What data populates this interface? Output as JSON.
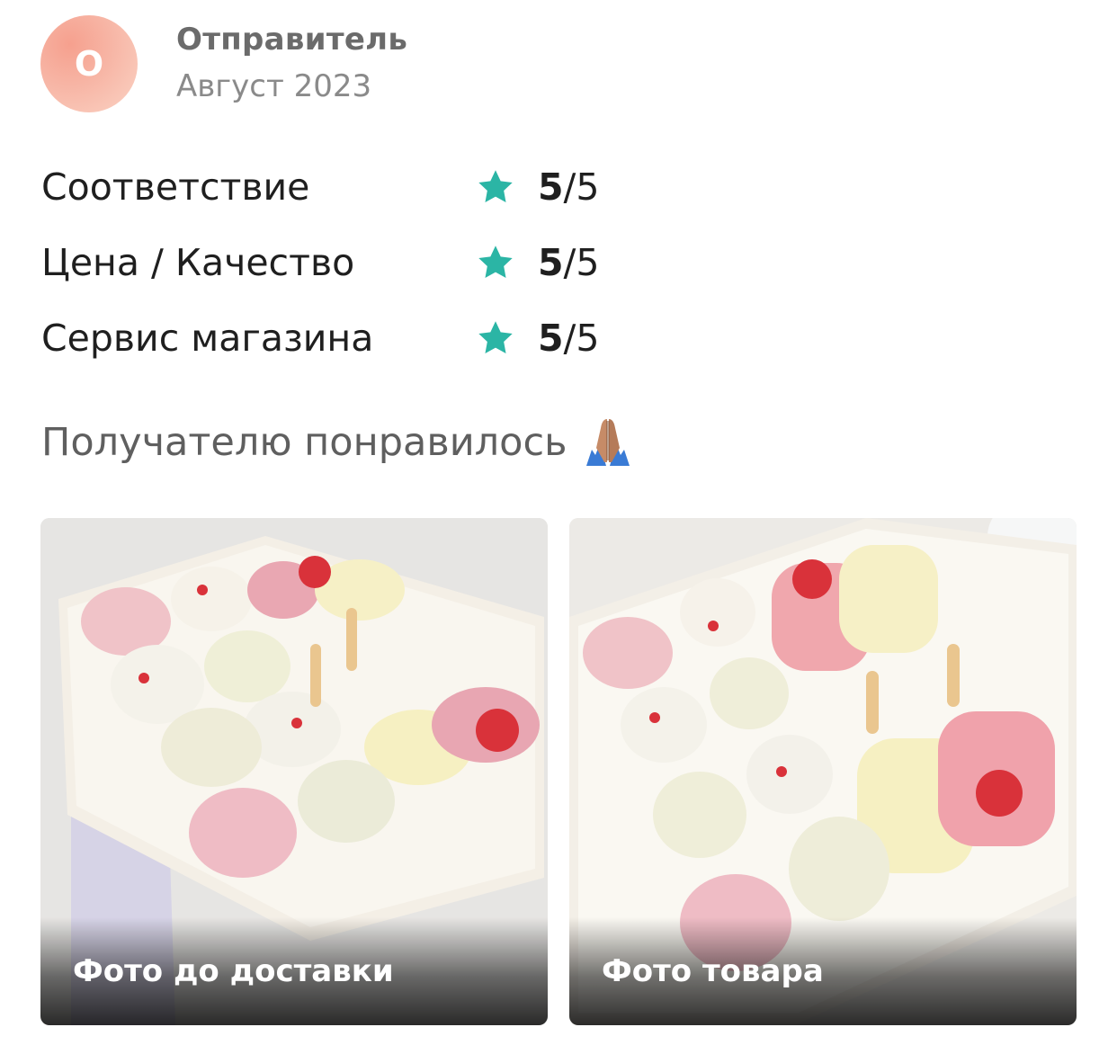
{
  "review": {
    "author": {
      "initial": "О",
      "name": "Отправитель",
      "date": "Август 2023",
      "avatar_color": "#f7b6a6"
    },
    "ratings": [
      {
        "label": "Соответствие",
        "score": "5",
        "max": "/5",
        "icon": "star-icon"
      },
      {
        "label": "Цена / Качество",
        "score": "5",
        "max": "/5",
        "icon": "star-icon"
      },
      {
        "label": "Сервис магазина",
        "score": "5",
        "max": "/5",
        "icon": "star-icon"
      }
    ],
    "accent_color": "#2bb5a5",
    "comment": "Получателю понравилось",
    "comment_emoji": "folded-hands-icon",
    "photos": [
      {
        "caption": "Фото до доставки"
      },
      {
        "caption": "Фото товара"
      }
    ]
  }
}
